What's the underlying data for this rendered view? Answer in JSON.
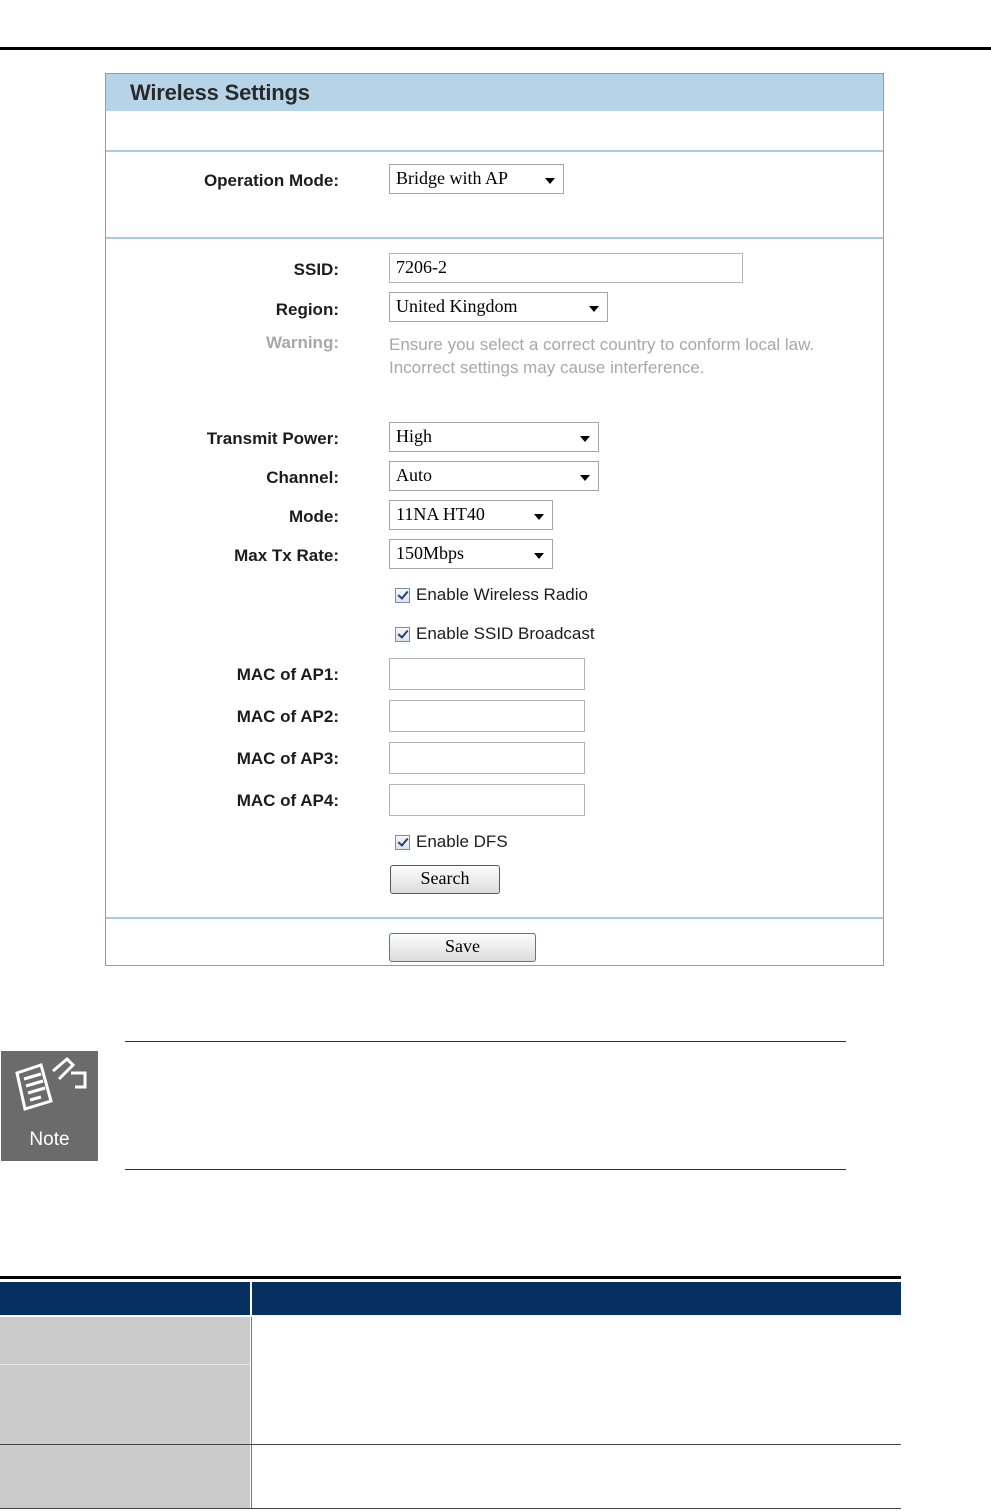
{
  "panel": {
    "title": "Wireless Settings",
    "operation_mode": {
      "label": "Operation Mode:",
      "value": "Bridge with AP"
    },
    "ssid": {
      "label": "SSID:",
      "value": "7206-2"
    },
    "region": {
      "label": "Region:",
      "value": "United Kingdom"
    },
    "warning": {
      "label": "Warning:",
      "line1": "Ensure you select a correct country to conform local law.",
      "line2": "Incorrect settings may cause interference."
    },
    "transmit_power": {
      "label": "Transmit Power:",
      "value": "High"
    },
    "channel": {
      "label": "Channel:",
      "value": "Auto"
    },
    "mode": {
      "label": "Mode:",
      "value": "11NA HT40"
    },
    "max_tx_rate": {
      "label": "Max Tx Rate:",
      "value": "150Mbps"
    },
    "enable_wireless_radio": {
      "label": "Enable Wireless Radio",
      "checked": true
    },
    "enable_ssid_broadcast": {
      "label": "Enable SSID Broadcast",
      "checked": true
    },
    "mac_ap1": {
      "label": "MAC of AP1:",
      "value": ""
    },
    "mac_ap2": {
      "label": "MAC of AP2:",
      "value": ""
    },
    "mac_ap3": {
      "label": "MAC of AP3:",
      "value": ""
    },
    "mac_ap4": {
      "label": "MAC of AP4:",
      "value": ""
    },
    "enable_dfs": {
      "label": "Enable DFS",
      "checked": true
    },
    "search_label": "Search",
    "save_label": "Save"
  },
  "note": {
    "icon_label": "Note"
  },
  "colors": {
    "panel_header": "#b6d4e8",
    "table_header": "#05305f",
    "table_label_cell": "#cbcbcb"
  }
}
